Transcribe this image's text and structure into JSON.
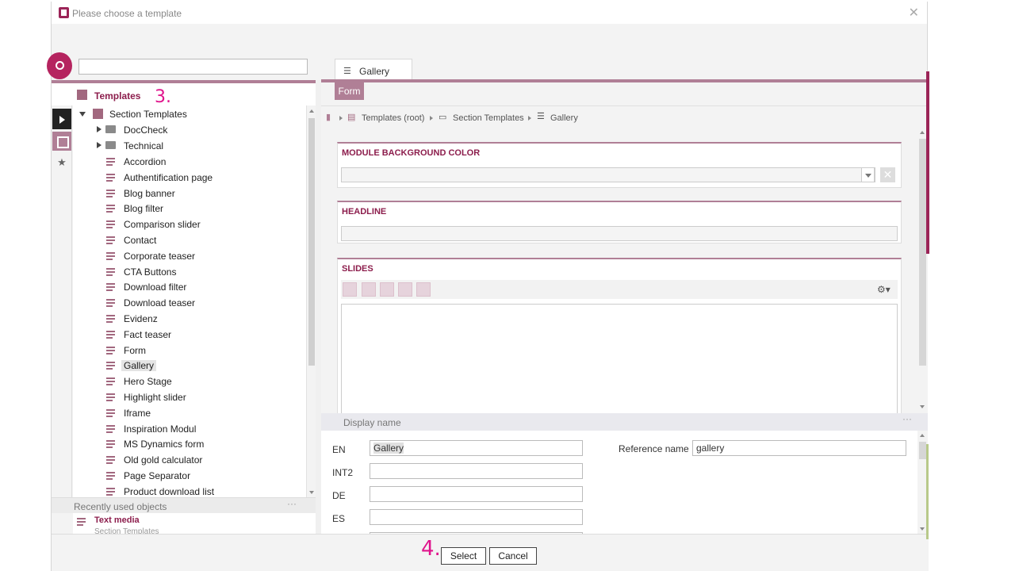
{
  "window": {
    "title": "Please choose a template",
    "close_icon": "✕"
  },
  "search": {
    "placeholder": "",
    "value": ""
  },
  "left_panel": {
    "header": "Templates",
    "tree": {
      "root": "Section Templates",
      "folders": [
        "DocCheck",
        "Technical"
      ],
      "items": [
        "Accordion",
        "Authentification page",
        "Blog banner",
        "Blog filter",
        "Comparison slider",
        "Contact",
        "Corporate teaser",
        "CTA Buttons",
        "Download filter",
        "Download teaser",
        "Evidenz",
        "Fact teaser",
        "Form",
        "Gallery",
        "Hero Stage",
        "Highlight slider",
        "Iframe",
        "Inspiration Modul",
        "MS Dynamics form",
        "Old gold calculator",
        "Page Separator",
        "Product download list"
      ],
      "selected": "Gallery"
    },
    "recent": {
      "title": "Recently used objects",
      "dots": "···",
      "item_name": "Text media",
      "item_path": "Section Templates"
    }
  },
  "annotations": {
    "step3": "3.",
    "step4": "4."
  },
  "right_panel": {
    "tab_label": "Gallery",
    "form_tab": "Form",
    "breadcrumb": [
      "Templates (root)",
      "Section Templates",
      "Gallery"
    ],
    "fields": {
      "bg_color": {
        "label": "MODULE BACKGROUND COLOR",
        "value": ""
      },
      "headline": {
        "label": "HEADLINE",
        "value": ""
      },
      "slides": {
        "label": "SLIDES"
      }
    },
    "display_name": {
      "title": "Display name",
      "dots": "···",
      "rows": [
        {
          "lang": "EN",
          "value": "Gallery"
        },
        {
          "lang": "INT2",
          "value": ""
        },
        {
          "lang": "DE",
          "value": ""
        },
        {
          "lang": "ES",
          "value": ""
        }
      ],
      "reference_label": "Reference name",
      "reference_value": "gallery"
    }
  },
  "footer": {
    "select": "Select",
    "cancel": "Cancel"
  },
  "colors": {
    "brand": "#9b2457",
    "accent": "#b07f96",
    "annotation": "#e0148c"
  }
}
